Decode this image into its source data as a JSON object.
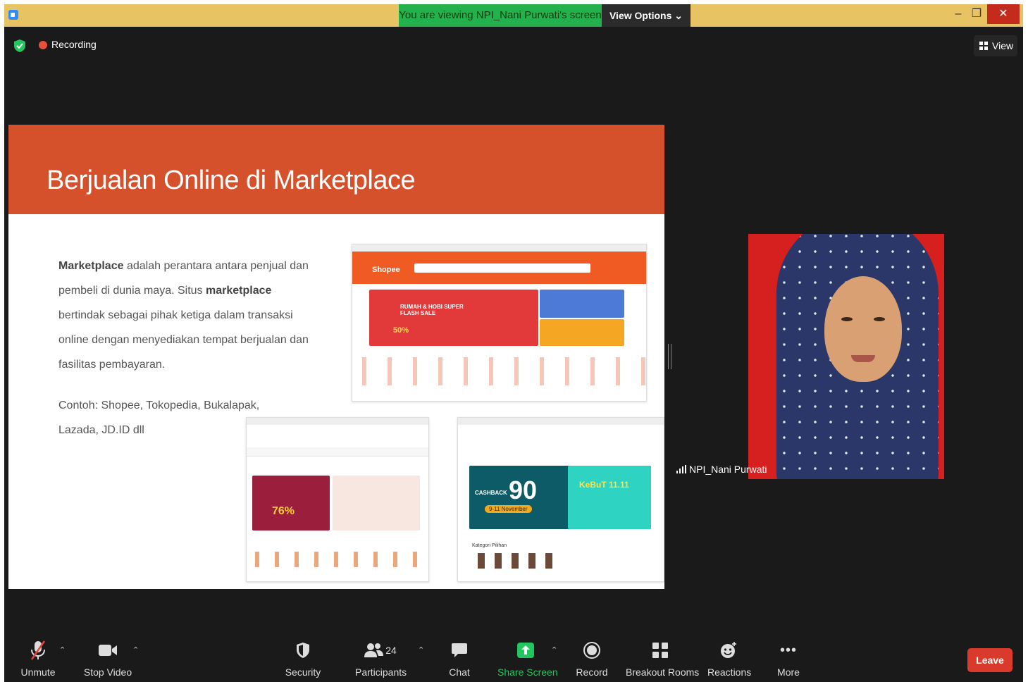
{
  "title_bar": {
    "share_banner": "You are viewing NPI_Nani Purwati's screen",
    "view_options": "View Options",
    "minimize": "–",
    "restore": "❐",
    "close": "✕"
  },
  "top_strip": {
    "recording_label": "Recording",
    "view_label": "View"
  },
  "slide": {
    "title": "Berjualan Online di Marketplace",
    "body_bold_1": "Marketplace",
    "body_text_1": " adalah perantara antara penjual dan pembeli di dunia maya. Situs ",
    "body_bold_2": "marketplace",
    "body_text_2": " bertindak sebagai pihak ketiga dalam transaksi online dengan menyediakan tempat berjualan dan fasilitas pembayaran.",
    "example": "Contoh: Shopee, Tokopedia, Bukalapak, Lazada, JD.ID dll",
    "shopee_logo": "Shopee",
    "shopee_banner_1": "RUMAH & HOBI SUPER FLASH SALE",
    "shopee_discount": "50%",
    "bukalapak_discount": "76%",
    "tokopedia_cashback": "CASHBACK",
    "tokopedia_value": "90",
    "tokopedia_dates": "9-11 November",
    "tokopedia_promo": "KeBuT 11.11",
    "tokopedia_section": "Kategori Pilihan"
  },
  "participant": {
    "name": "NPI_Nani Purwati"
  },
  "toolbar": {
    "unmute": "Unmute",
    "stop_video": "Stop Video",
    "security": "Security",
    "participants": "Participants",
    "participants_count": "24",
    "chat": "Chat",
    "share_screen": "Share Screen",
    "record": "Record",
    "breakout_rooms": "Breakout Rooms",
    "reactions": "Reactions",
    "more": "More",
    "leave": "Leave"
  }
}
